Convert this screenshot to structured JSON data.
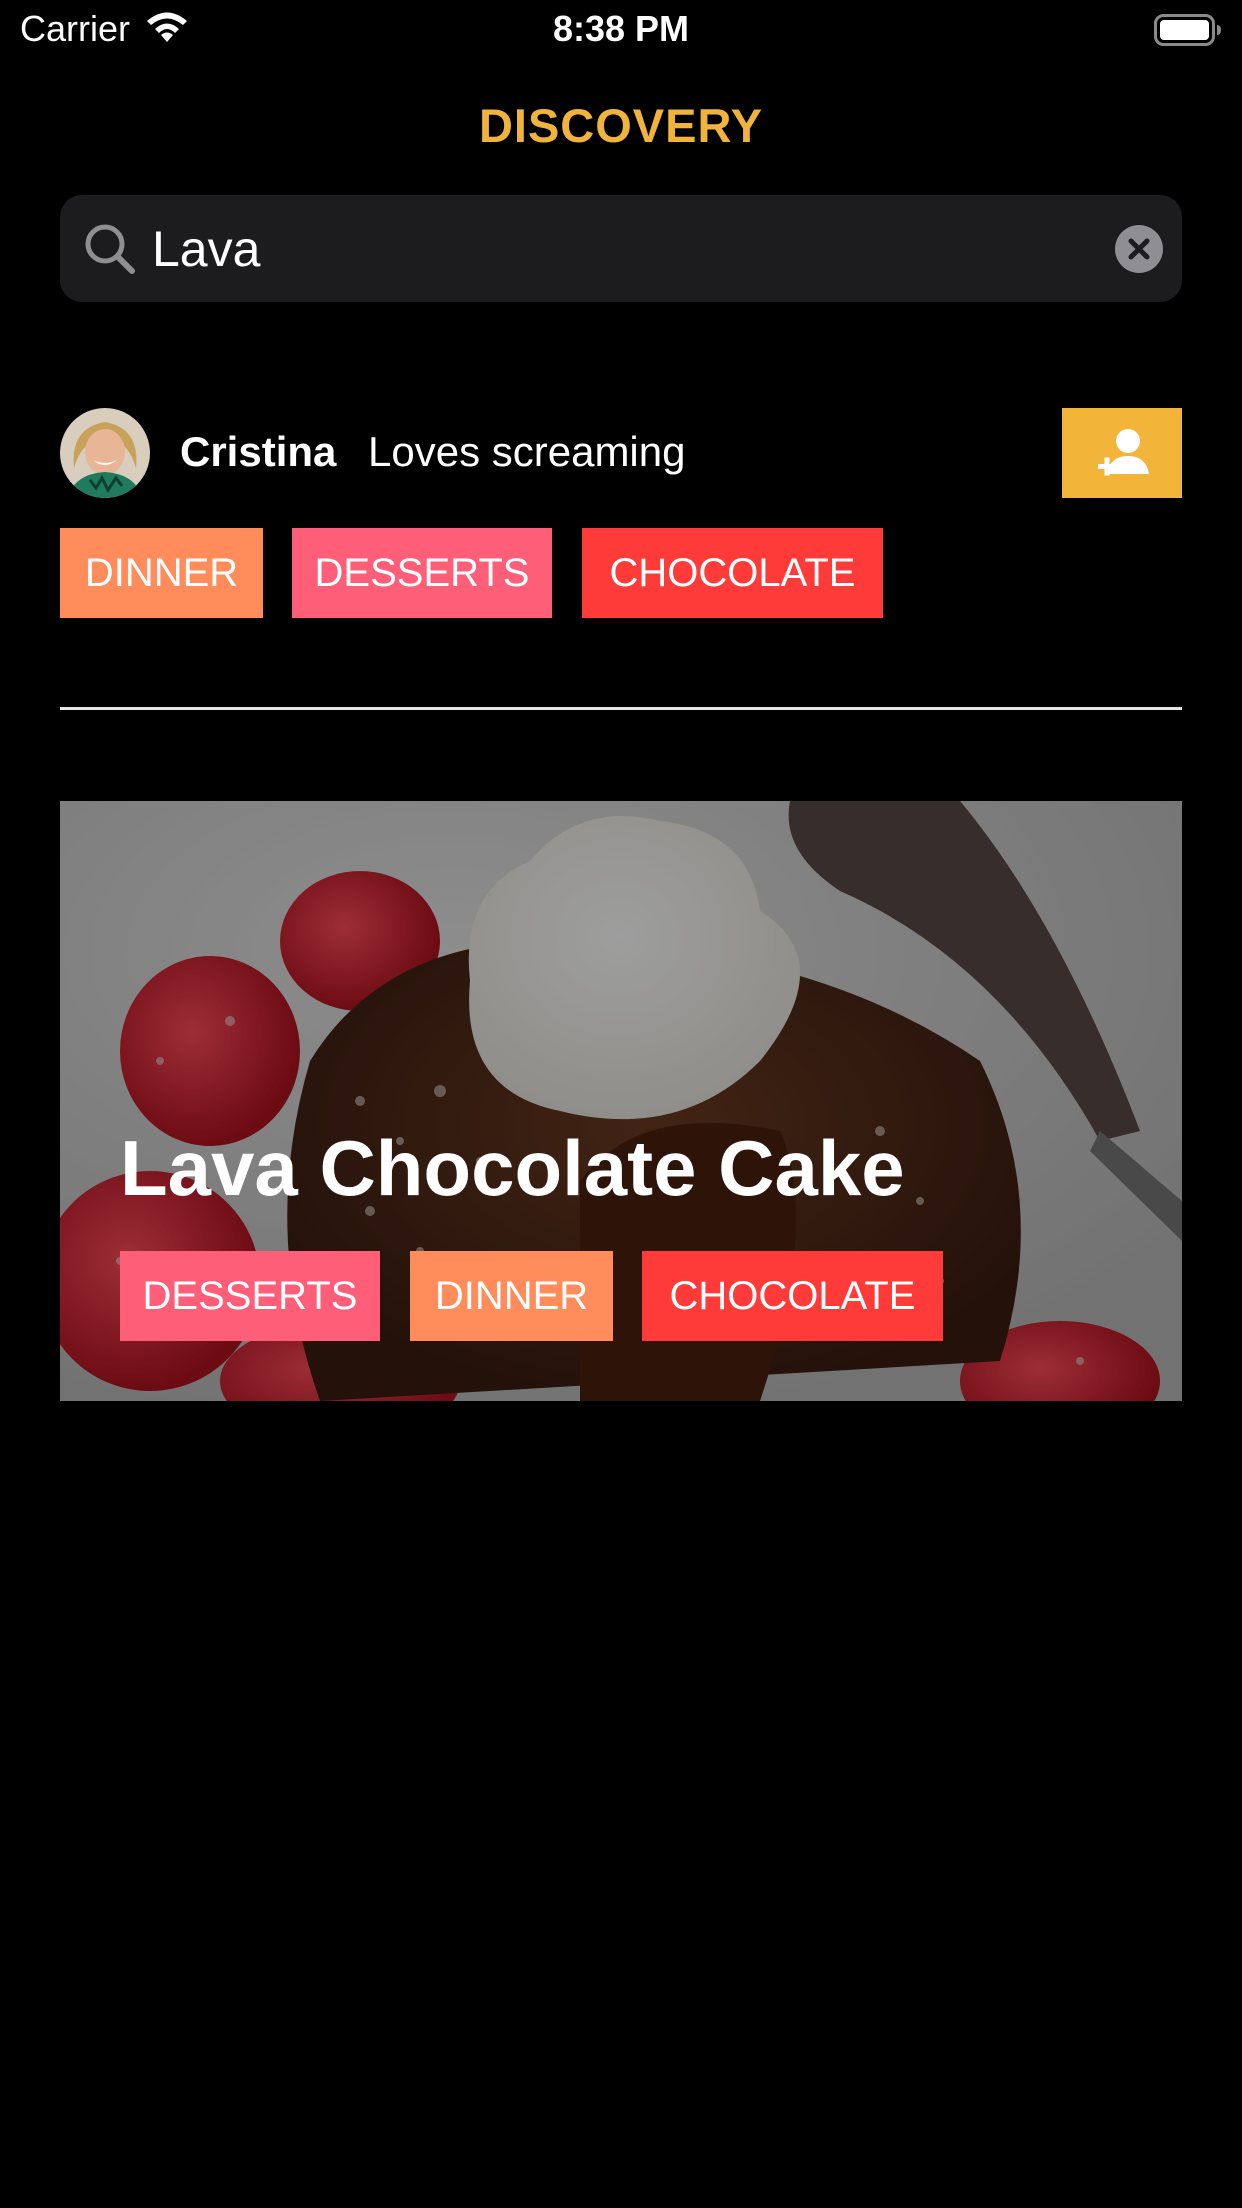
{
  "status_bar": {
    "carrier": "Carrier",
    "time": "8:38 PM",
    "wifi_icon": "wifi-icon",
    "battery_icon": "battery-icon"
  },
  "header": {
    "title": "DISCOVERY",
    "title_color": "#F0B43C"
  },
  "search": {
    "value": "Lava",
    "search_icon": "search-icon",
    "clear_icon": "clear-icon"
  },
  "user": {
    "name": "Cristina",
    "bio": "Loves screaming",
    "follow_icon": "add-user-icon",
    "follow_color": "#F3B43A",
    "tags": [
      {
        "label": "DINNER",
        "color": "#FF8C5A"
      },
      {
        "label": "DESSERTS",
        "color": "#FF5E78"
      },
      {
        "label": "CHOCOLATE",
        "color": "#FF3B3A"
      }
    ]
  },
  "recipe": {
    "title": "Lava Chocolate Cake",
    "tags": [
      {
        "label": "DESSERTS",
        "color": "#FF5E78"
      },
      {
        "label": "DINNER",
        "color": "#FF8C5A"
      },
      {
        "label": "CHOCOLATE",
        "color": "#FF3B3A"
      }
    ]
  }
}
